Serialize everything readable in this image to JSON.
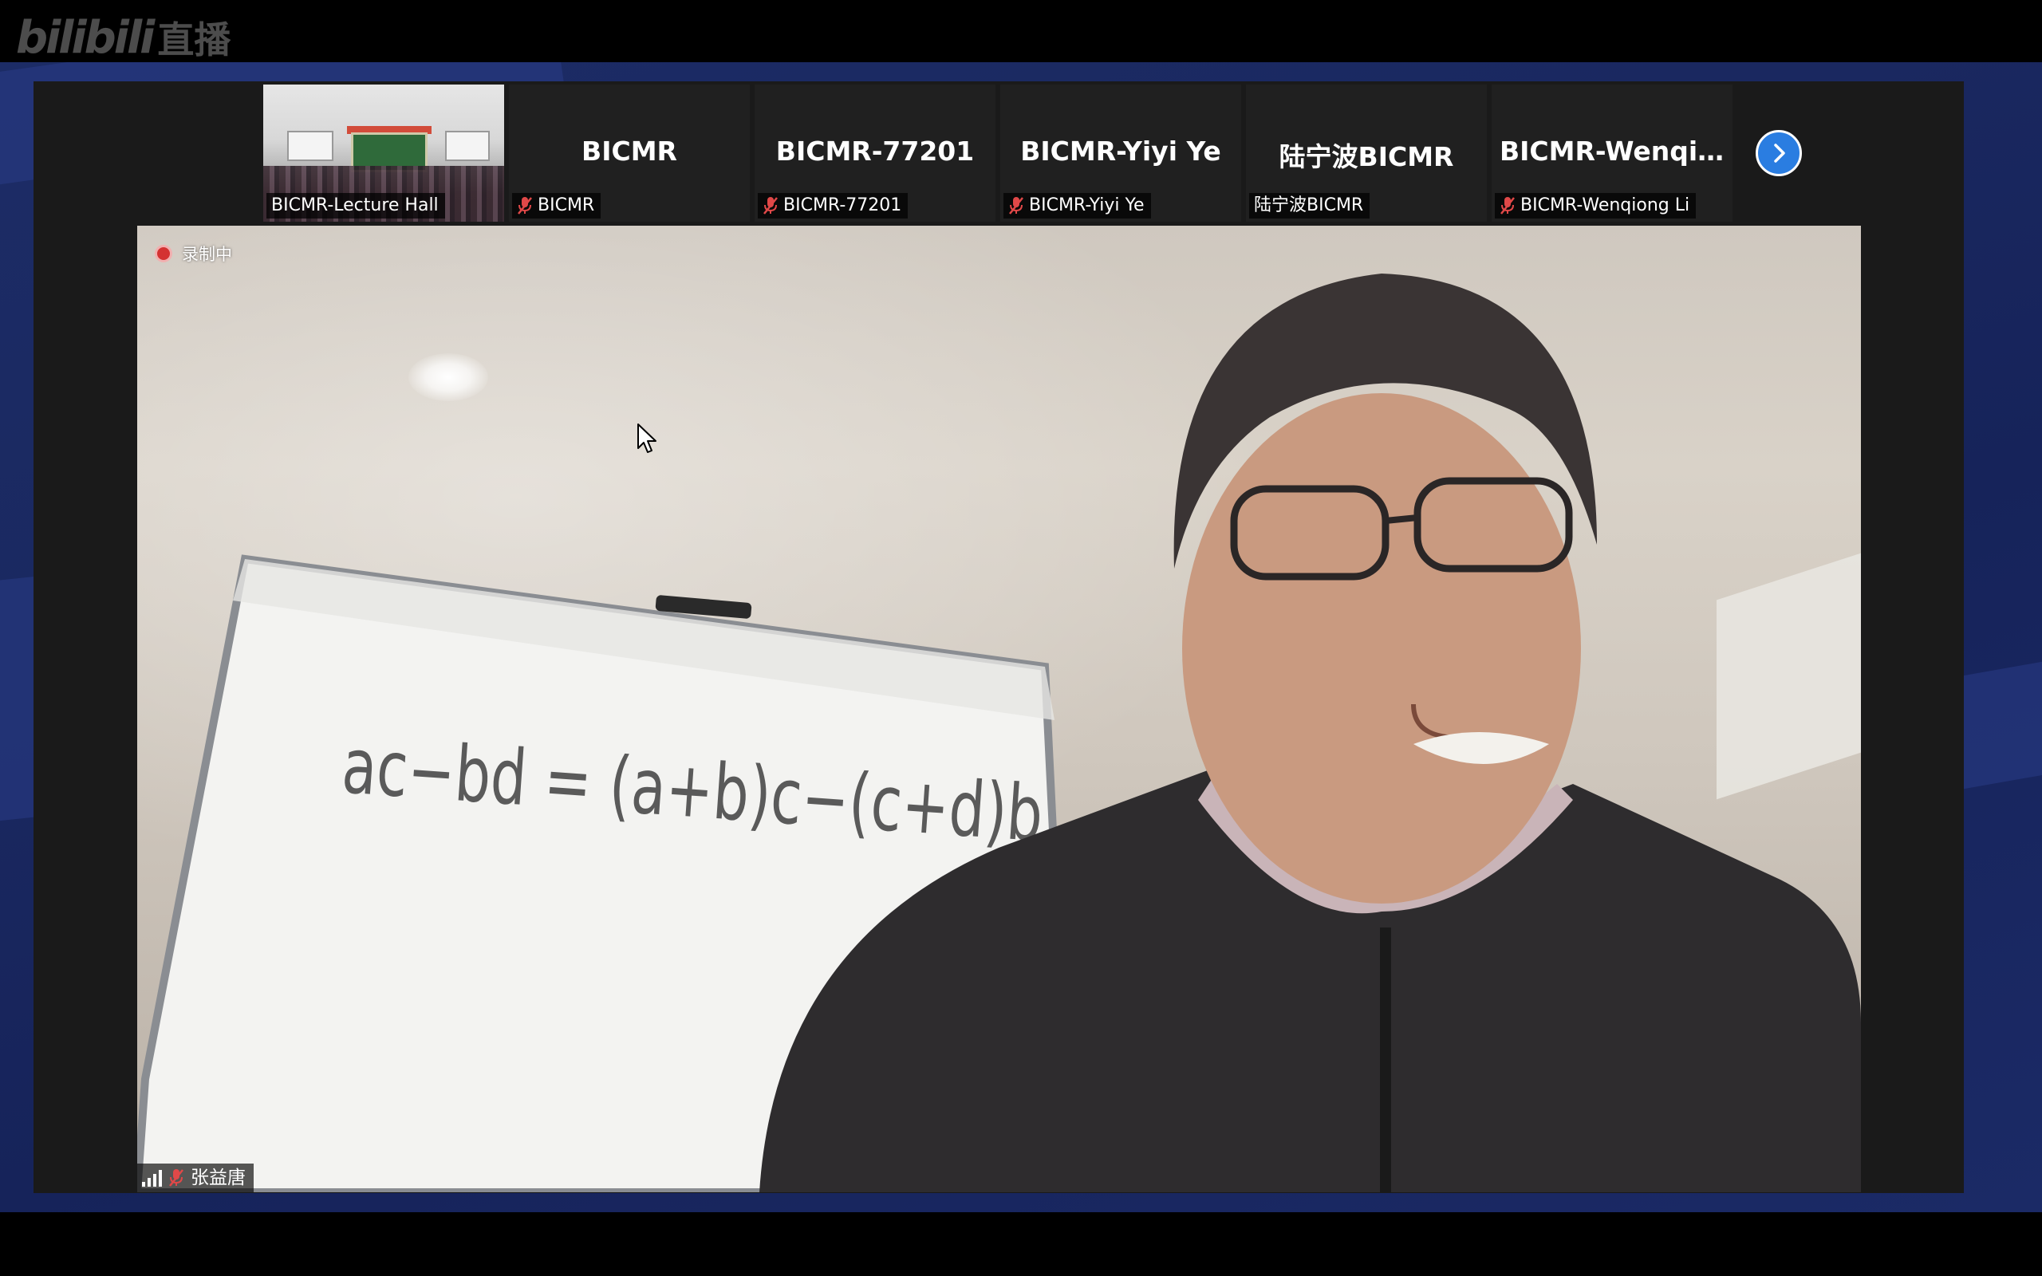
{
  "watermark": {
    "brand": "bilibili",
    "suffix": "直播"
  },
  "gallery": {
    "tiles": [
      {
        "kind": "video",
        "label": "BICMR-Lecture Hall",
        "muted": false
      },
      {
        "kind": "name",
        "name": "BICMR",
        "label": "BICMR",
        "muted": true
      },
      {
        "kind": "name",
        "name": "BICMR-77201",
        "label": "BICMR-77201",
        "muted": true
      },
      {
        "kind": "name",
        "name": "BICMR-Yiyi Ye",
        "label": "BICMR-Yiyi Ye",
        "muted": true
      },
      {
        "kind": "name",
        "name": "陆宁波BICMR",
        "label": "陆宁波BICMR",
        "muted": false
      },
      {
        "kind": "name",
        "name": "BICMR-Wenqio...",
        "label": "BICMR-Wenqiong Li",
        "muted": true
      }
    ],
    "next_icon": "chevron-right-icon"
  },
  "main_video": {
    "recording_text": "录制中",
    "speaker_name": "张益唐",
    "speaker_muted": true,
    "whiteboard_text": "ac−bd = (a+b)c−(c+d)b"
  },
  "colors": {
    "accent_blue": "#2a7de1",
    "recording_red": "#d43232",
    "muted_red": "#e04848",
    "backdrop_blue": "#1a2860"
  }
}
